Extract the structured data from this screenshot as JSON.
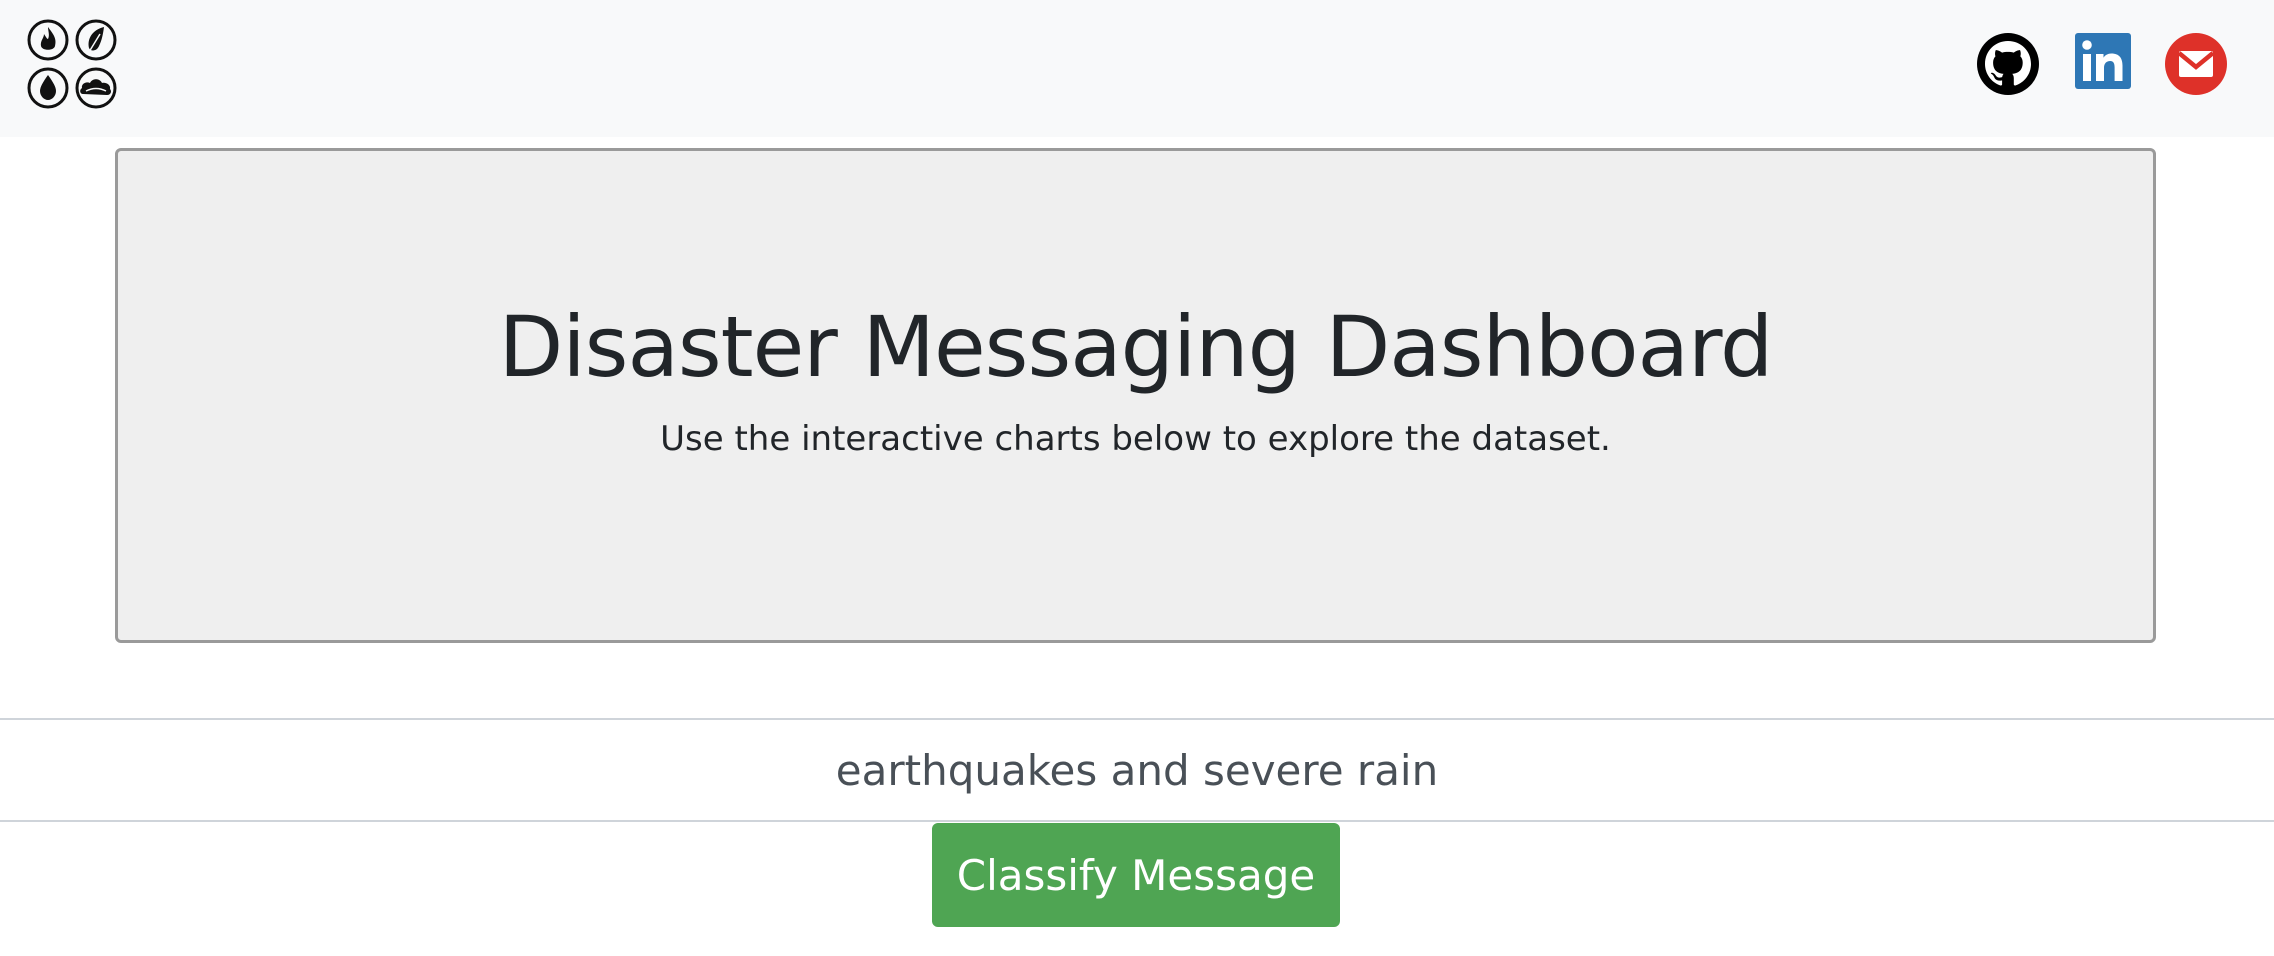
{
  "navbar": {
    "logo_icon": "four-elements-logo-icon",
    "social_links": [
      {
        "name": "github-icon",
        "color": "#000000"
      },
      {
        "name": "linkedin-icon",
        "color": "#2e77b5"
      },
      {
        "name": "email-icon",
        "color": "#de3129"
      }
    ]
  },
  "jumbotron": {
    "title": "Disaster Messaging Dashboard",
    "subtitle": "Use the interactive charts below to explore the dataset."
  },
  "message_form": {
    "input_value": "earthquakes and severe rain",
    "classify_label": "Classify Message",
    "button_color": "#4fa553"
  }
}
